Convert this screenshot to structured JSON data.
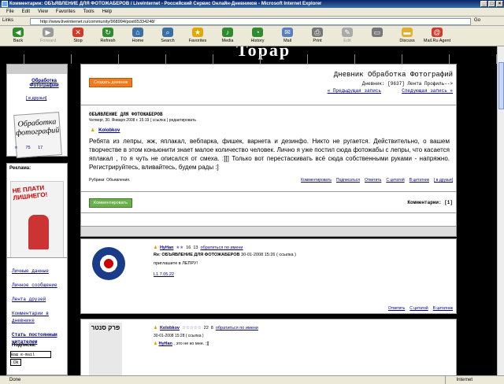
{
  "window": {
    "title": "Комментарии: ОБЪЯВЛЕНИЕ ДЛЯ ФОТОЖАБЕРОВ / LiveInternet - Российский Сервис Онлайн-Дневников - Microsoft Internet Explorer"
  },
  "menu": [
    "File",
    "Edit",
    "View",
    "Favorites",
    "Tools",
    "Help"
  ],
  "address": {
    "label": "Links",
    "address_label": "Address",
    "url": "http://www.liveinternet.ru/community/968994/post65334248/",
    "go": "Go"
  },
  "toolbar": [
    {
      "label": "Back",
      "icon": "back-arrow-icon",
      "color": "#2e8b2e",
      "glyph": "◀"
    },
    {
      "label": "Forward",
      "icon": "forward-arrow-icon",
      "color": "#9a9a9a",
      "glyph": "▶",
      "disabled": true
    },
    {
      "label": "Stop",
      "icon": "stop-icon",
      "color": "#d03a2a",
      "glyph": "✕"
    },
    {
      "label": "Refresh",
      "icon": "refresh-icon",
      "color": "#2e8b2e",
      "glyph": "↻"
    },
    {
      "label": "Home",
      "icon": "home-icon",
      "color": "#3a6ea5",
      "glyph": "⌂"
    },
    {
      "label": "Search",
      "icon": "search-icon",
      "color": "#3a6ea5",
      "glyph": "⌕"
    },
    {
      "label": "Favorites",
      "icon": "star-icon",
      "color": "#e0a800",
      "glyph": "★"
    },
    {
      "label": "Media",
      "icon": "media-icon",
      "color": "#2e8b2e",
      "glyph": "♪"
    },
    {
      "label": "History",
      "icon": "history-icon",
      "color": "#2e8b2e",
      "glyph": "◔"
    },
    {
      "label": "Mail",
      "icon": "mail-icon",
      "color": "#5a7fbf",
      "glyph": "✉"
    },
    {
      "label": "Print",
      "icon": "print-icon",
      "color": "#777",
      "glyph": "⎙"
    },
    {
      "label": "Edit",
      "icon": "edit-icon",
      "color": "#aaa",
      "glyph": "✎",
      "disabled": true
    },
    {
      "label": "",
      "icon": "discuss-icon",
      "color": "#777",
      "glyph": "▭"
    },
    {
      "label": "Discuss",
      "icon": "folder-icon",
      "color": "#e0b030",
      "glyph": "▬"
    },
    {
      "label": "Mail.Ru Agent",
      "icon": "mailru-agent-icon",
      "color": "#d03a2a",
      "glyph": "@"
    }
  ],
  "status": {
    "text": "Done",
    "zone": "Internet"
  },
  "sidebar": {
    "community_name": "Обработка Фотографий",
    "friends_link": "[ в друзья]",
    "logo_text": "Обработка фотографий",
    "stat1": "75",
    "stat2": "17",
    "ad_title": "Реклама:",
    "ad_text": "НЕ ПЛАТИ ЛИШНЕГО!",
    "links": [
      "Личные данные",
      "Личное сообщение",
      "Лента друзей",
      "Комментарии в дневнике",
      "Стать постоянным читателем"
    ],
    "subscribe_label": "Подписка:",
    "email_placeholder": "Ваш e-mail",
    "ok": "Ok"
  },
  "header": {
    "create_button": "Создать дневник",
    "diary_title": "Дневник Обработка Фотографий",
    "diary_line": "Дневник: [9637]  Лента  Профиль-->",
    "nav_prev": "« Предыдущая запись",
    "nav_next": "Следующая запись »"
  },
  "post": {
    "title": "ОБЪЯВЛЕНИЕ ДЛЯ ФОТОЖАБЕРОВ",
    "meta": "Четверг, 30. Января 2008 г. 15:19  ( ссылка )  редактировать",
    "author": "Kolobkov",
    "body": "Ребята из лепры, жж, яплакал, вебпарка, фишек, варнета и дезинфо. Никто не ругается. Действительно, о вашем творчестве в этом коньюнити знает малое количество человек. Лично я уже постил сюда фотожабы с лепры, что касается яплакал , то я чуть не описался от смеха. :]]] Только вот перестаскивать всё сюда собственными руками - напряжно. Регистрируйтесь, вливайтесь, будем рады :]",
    "rubric": "Рубрики: Объявления.",
    "actions": [
      "Комментировать",
      "Подписаться",
      "Ответить",
      "С цитатой",
      "В цитатник",
      "[ в друзья]"
    ]
  },
  "comments_bar": {
    "button": "Комментировать",
    "count": "Комментарии: [1]"
  },
  "comment1": {
    "author": "HyHan",
    "stat1": "16",
    "stat2": "13",
    "contact": "обратиться по имени",
    "subject": "Re: ОБЪЯВЛЕНИЕ ДЛЯ ФОТОЖАБЕРОВ",
    "meta": "30-01-2008 15:26  ( ссылка )",
    "text": "приглашите в ЛЕПРУ!",
    "signature": "L1 7.05.22",
    "actions": [
      "Ответить",
      "С цитатой",
      "В цитатник"
    ]
  },
  "comment2": {
    "author": "Kolobkov",
    "stat1": "22",
    "stat2": "8",
    "contact": "обратиться по имени",
    "meta": "30-01-2008 15:28  ( ссылка )",
    "reply_to": "HyHan",
    "reply_text": ", это не ко мне. :]]",
    "avatar_text": "פרק סנטר"
  }
}
